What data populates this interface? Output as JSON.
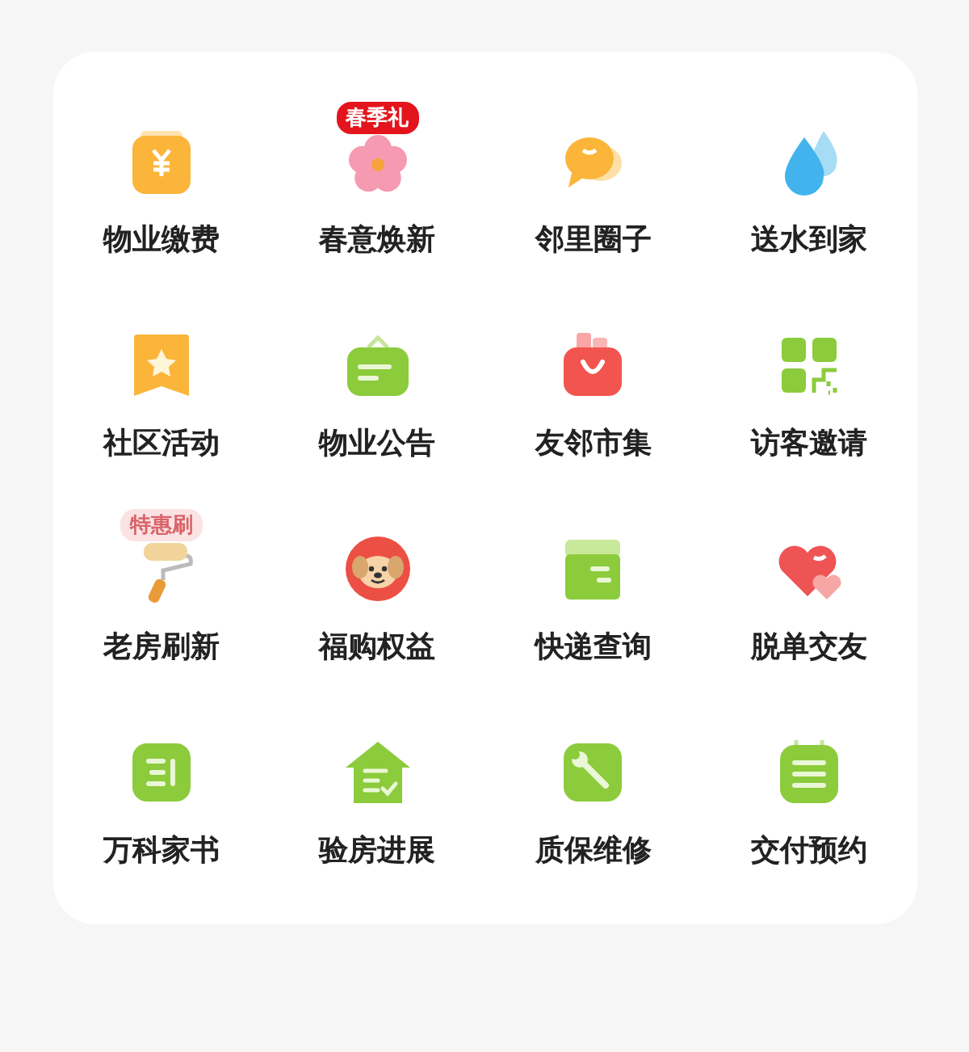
{
  "services": [
    {
      "label": "物业缴费",
      "kind": "bill"
    },
    {
      "label": "春意焕新",
      "kind": "flower",
      "badge": {
        "text": "春季礼",
        "faded": false
      }
    },
    {
      "label": "邻里圈子",
      "kind": "chat"
    },
    {
      "label": "送水到家",
      "kind": "water"
    },
    {
      "label": "社区活动",
      "kind": "ribbon"
    },
    {
      "label": "物业公告",
      "kind": "notice"
    },
    {
      "label": "友邻市集",
      "kind": "bag"
    },
    {
      "label": "访客邀请",
      "kind": "qr"
    },
    {
      "label": "老房刷新",
      "kind": "roller",
      "badge": {
        "text": "特惠刷",
        "faded": true
      }
    },
    {
      "label": "福购权益",
      "kind": "dog"
    },
    {
      "label": "快递查询",
      "kind": "box"
    },
    {
      "label": "脱单交友",
      "kind": "heart"
    },
    {
      "label": "万科家书",
      "kind": "book"
    },
    {
      "label": "验房进展",
      "kind": "house"
    },
    {
      "label": "质保维修",
      "kind": "wrench"
    },
    {
      "label": "交付预约",
      "kind": "calendar"
    }
  ]
}
